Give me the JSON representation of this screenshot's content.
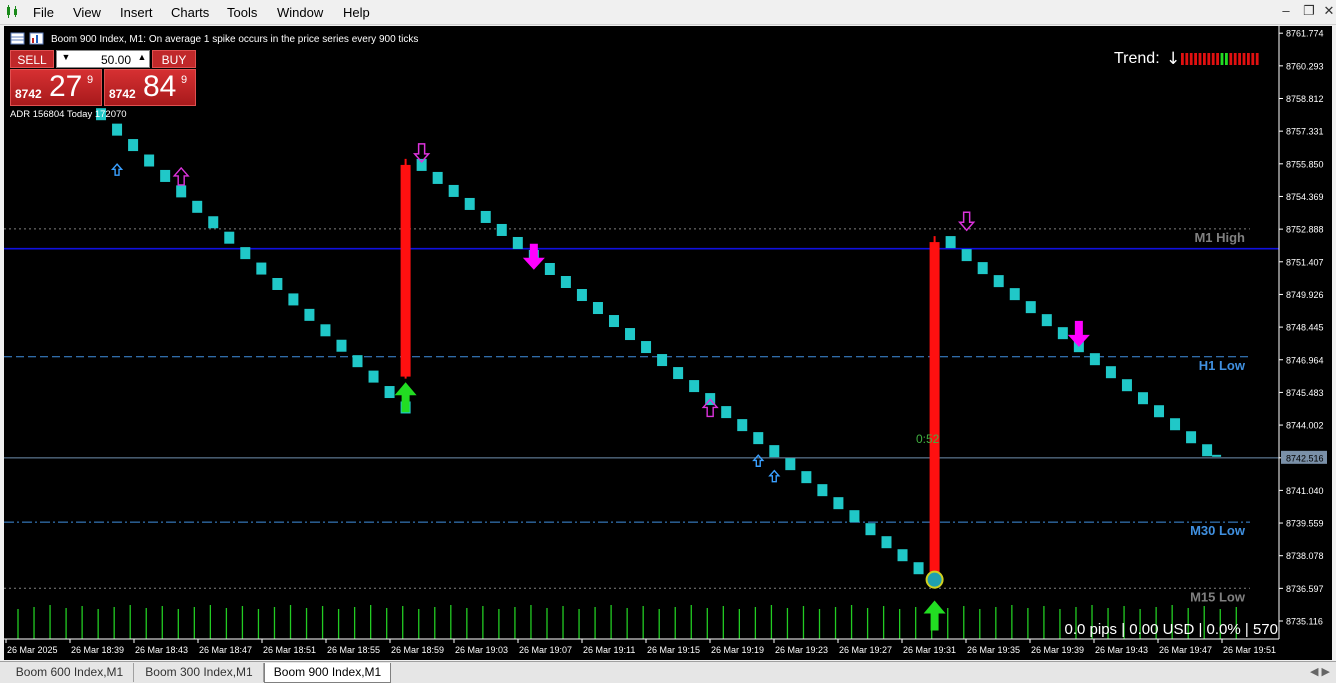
{
  "menu": [
    "File",
    "View",
    "Insert",
    "Charts",
    "Tools",
    "Window",
    "Help"
  ],
  "window_controls": [
    "–",
    "❐",
    "✕"
  ],
  "chart": {
    "header": "Boom 900 Index, M1:  On average 1 spike occurs in the price series every 900 ticks",
    "adr_text": "ADR 156804  Today 172070",
    "trend_label": "Trend:",
    "trend_arrow": "↓",
    "countdown": "0:52",
    "stats": "0.0 pips | 0.00 USD | 0.0% | 570",
    "current_price_label": "8742.516",
    "colors": {
      "bg": "#000000",
      "candle": "#20c8c8",
      "spike": "#ff1010",
      "volume": "#22cc22",
      "up_arrow": "#22dd22",
      "down_arrow": "#ff00ff",
      "blue_line": "#1010e0",
      "level_blue": "#4090e0",
      "level_gray": "#808080"
    },
    "price_axis": [
      "8761.774",
      "8760.293",
      "8758.812",
      "8757.331",
      "8755.850",
      "8754.369",
      "8752.888",
      "8751.407",
      "8749.926",
      "8748.445",
      "8746.964",
      "8745.483",
      "8744.002",
      "8742.516",
      "8741.040",
      "8739.559",
      "8738.078",
      "8736.597",
      "8735.116"
    ],
    "time_axis": [
      "26 Mar 2025",
      "26 Mar 18:39",
      "26 Mar 18:43",
      "26 Mar 18:47",
      "26 Mar 18:51",
      "26 Mar 18:55",
      "26 Mar 18:59",
      "26 Mar 19:03",
      "26 Mar 19:07",
      "26 Mar 19:11",
      "26 Mar 19:15",
      "26 Mar 19:19",
      "26 Mar 19:23",
      "26 Mar 19:27",
      "26 Mar 19:31",
      "26 Mar 19:35",
      "26 Mar 19:39",
      "26 Mar 19:43",
      "26 Mar 19:47",
      "26 Mar 19:51"
    ],
    "levels": [
      {
        "name": "M1 High",
        "price": 8752.9,
        "style": "dotted",
        "color": "#808080"
      },
      {
        "name": "",
        "price": 8752.0,
        "style": "solid",
        "color": "#1010e0"
      },
      {
        "name": "H1 Low",
        "price": 8747.1,
        "style": "dashed",
        "color": "#4090e0"
      },
      {
        "name": "M30 Low",
        "price": 8739.6,
        "style": "dashdot",
        "color": "#4090e0"
      },
      {
        "name": "M15 Low",
        "price": 8736.6,
        "style": "dotted",
        "color": "#808080"
      }
    ],
    "current_price": 8742.516
  },
  "trade_panel": {
    "sell_label": "SELL",
    "buy_label": "BUY",
    "lot": "50.00",
    "bid_small": "8742",
    "bid_big": "27",
    "bid_sup": "9",
    "ask_small": "8742",
    "ask_big": "84",
    "ask_sup": "9"
  },
  "chart_data": {
    "type": "candlestick",
    "title": "Boom 900 Index, M1",
    "ylim": [
      8734.3,
      8762.1
    ],
    "x_labels": [
      "26 Mar 2025",
      "26 Mar 18:39",
      "26 Mar 18:43",
      "26 Mar 18:47",
      "26 Mar 18:51",
      "26 Mar 18:55",
      "26 Mar 18:59",
      "26 Mar 19:03",
      "26 Mar 19:07",
      "26 Mar 19:11",
      "26 Mar 19:15",
      "26 Mar 19:19",
      "26 Mar 19:23",
      "26 Mar 19:27",
      "26 Mar 19:31",
      "26 Mar 19:35",
      "26 Mar 19:39",
      "26 Mar 19:43",
      "26 Mar 19:47",
      "26 Mar 19:51"
    ],
    "segments": [
      {
        "start_index": 0,
        "count": 21,
        "start_price": 8758.8,
        "step": -0.7
      },
      {
        "start_index": 21,
        "count": 33,
        "start_price": 8755.8,
        "step": -0.59
      },
      {
        "start_index": 54,
        "count": 17,
        "start_price": 8752.3,
        "step": -0.59
      }
    ],
    "spikes": [
      {
        "index": 20,
        "open": 8746.2,
        "close": 8755.8
      },
      {
        "index": 53,
        "open": 8736.9,
        "close": 8752.3
      }
    ],
    "signals": [
      {
        "index": 20,
        "kind": "buy-arrow",
        "price": 8745.4
      },
      {
        "index": 53,
        "kind": "buy-arrow",
        "price": 8735.5
      },
      {
        "index": 21,
        "kind": "hollow-down",
        "price": 8756.3
      },
      {
        "index": 55,
        "kind": "hollow-down",
        "price": 8753.2
      },
      {
        "index": 28,
        "kind": "down-arrow",
        "price": 8751.5
      },
      {
        "index": 62,
        "kind": "down-arrow",
        "price": 8748.0
      },
      {
        "index": 2,
        "kind": "hollow-up",
        "price": 8755.6
      },
      {
        "index": 6,
        "kind": "hollow-up",
        "price": 8755.3
      },
      {
        "index": 39,
        "kind": "hollow-up",
        "price": 8744.8
      },
      {
        "index": 42,
        "kind": "hollow-up",
        "price": 8742.4
      },
      {
        "index": 43,
        "kind": "hollow-up",
        "price": 8741.7
      }
    ],
    "trend_meter": [
      "#e01010",
      "#e01010",
      "#e01010",
      "#e01010",
      "#e01010",
      "#e01010",
      "#e01010",
      "#e01010",
      "#e01010",
      "#22dd22",
      "#22dd22",
      "#e01010",
      "#e01010",
      "#e01010",
      "#e01010",
      "#e01010",
      "#e01010",
      "#e01010"
    ]
  },
  "tabs": [
    {
      "label": "Boom 600 Index,M1",
      "active": false
    },
    {
      "label": "Boom 300 Index,M1",
      "active": false
    },
    {
      "label": "Boom 900 Index,M1",
      "active": true
    }
  ],
  "tab_nav": "◀ ▶"
}
